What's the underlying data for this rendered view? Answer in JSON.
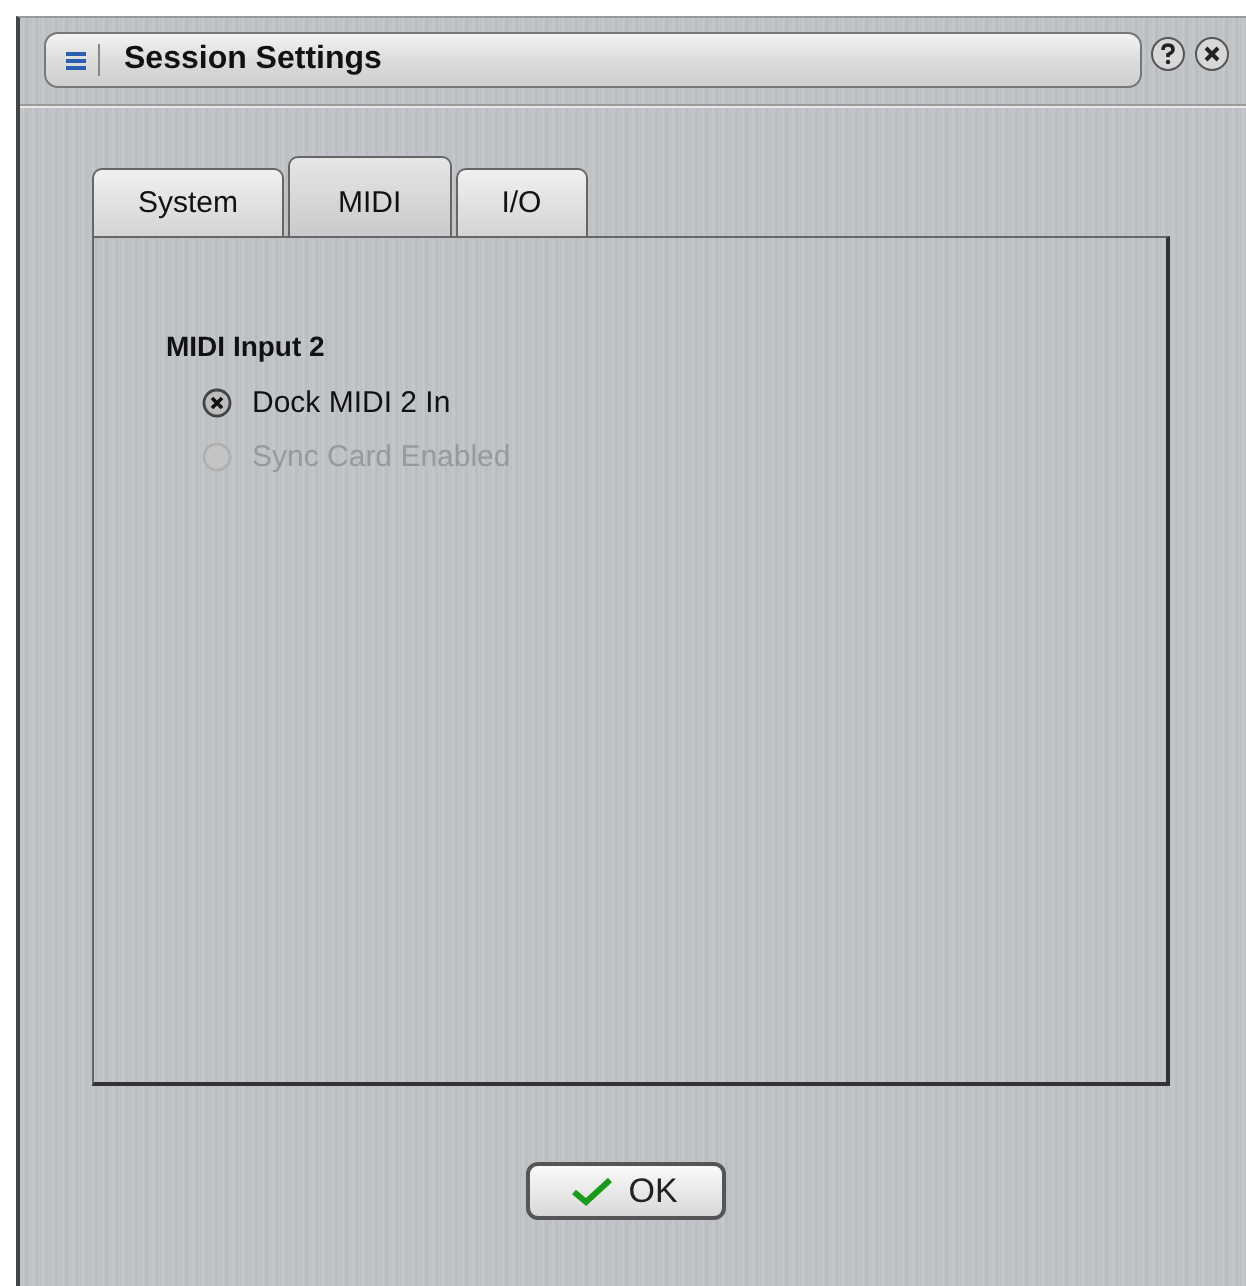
{
  "window": {
    "title": "Session Settings"
  },
  "tabs": [
    {
      "label": "System",
      "selected": false
    },
    {
      "label": "MIDI",
      "selected": true
    },
    {
      "label": "I/O",
      "selected": false
    }
  ],
  "group": {
    "title": "MIDI Input 2",
    "options": [
      {
        "label": "Dock MIDI 2 In",
        "selected": true,
        "disabled": false
      },
      {
        "label": "Sync Card Enabled",
        "selected": false,
        "disabled": true
      }
    ]
  },
  "buttons": [
    {
      "label": "OK"
    }
  ]
}
